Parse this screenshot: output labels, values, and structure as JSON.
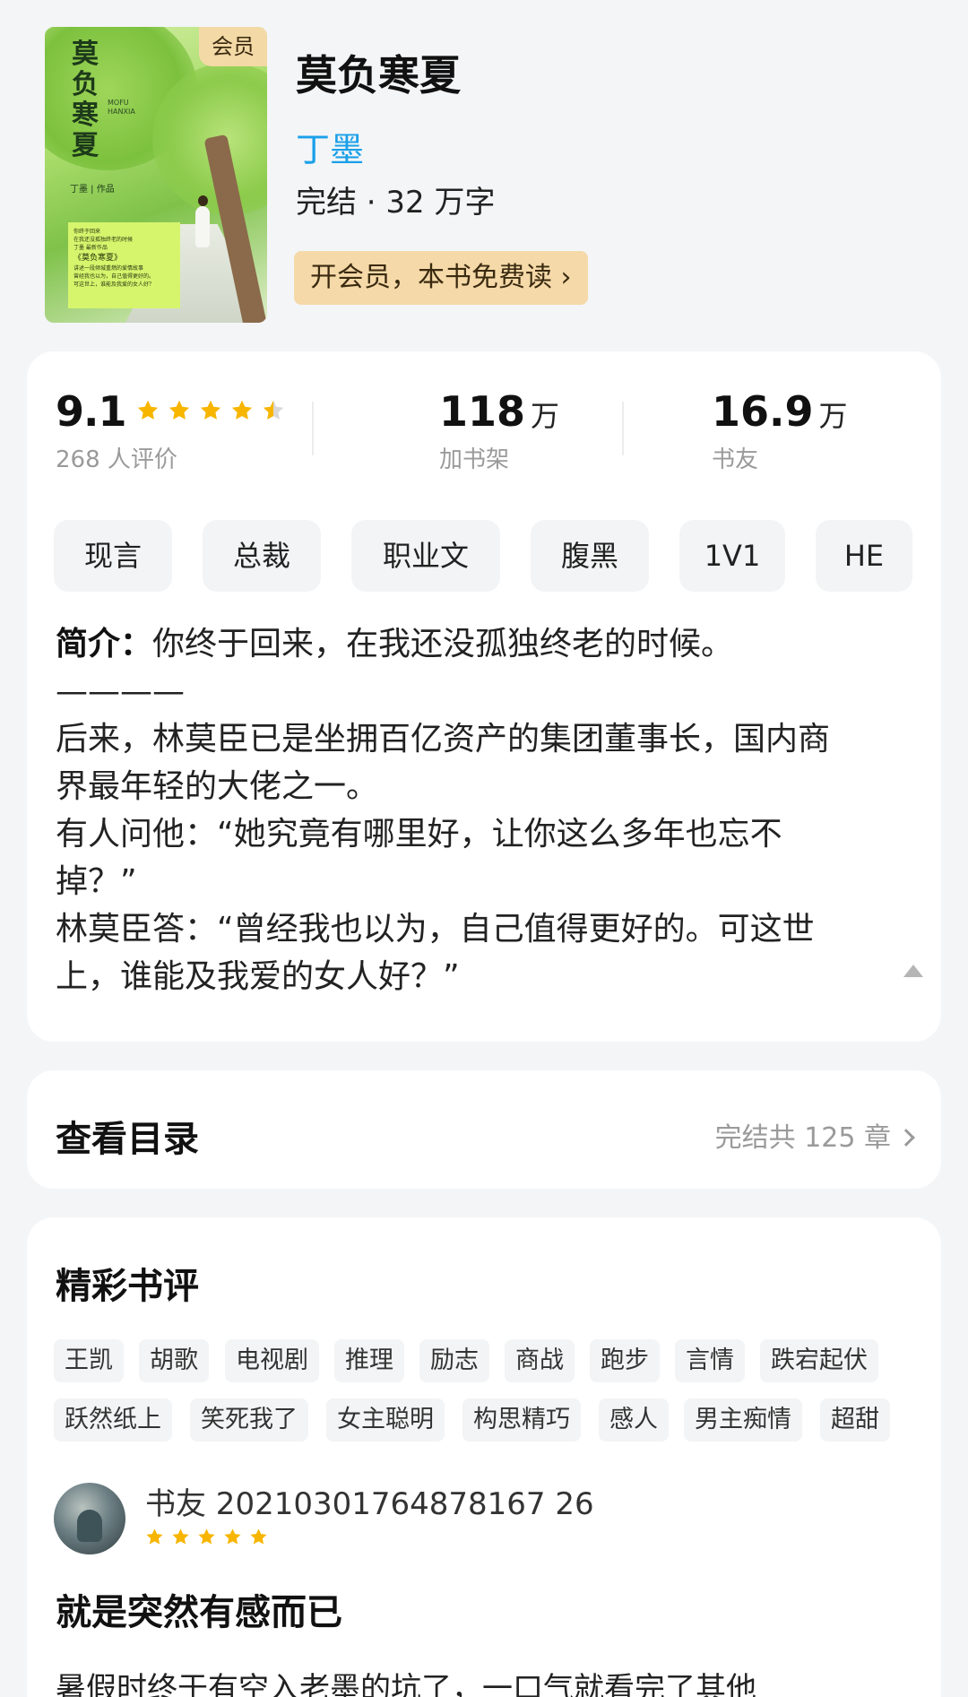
{
  "book": {
    "title": "莫负寒夏",
    "author": "丁墨",
    "meta": "完结 · 32 万字",
    "badge": "会员",
    "vip_button": "开会员，本书免费读 ›",
    "cover": {
      "title": "莫负\n寒夏",
      "latin": "MOFU\nHANXIA",
      "author_line": "丁墨 | 作品",
      "box_lines": [
        "你终于回来",
        "在我还没孤独终老的时候",
        "丁墨 最新作品"
      ],
      "box_book": "《莫负寒夏》",
      "box_tail": [
        "讲述一段倾城重燃的爱情故事",
        "曾经我也以为，自己值得更好的。",
        "可这世上，谁能及我爱的女人好？"
      ]
    }
  },
  "stats": {
    "score": "9.1",
    "rating_count": "268 人评价",
    "shelf_value": "118",
    "shelf_unit": "万",
    "shelf_label": "加书架",
    "friends_value": "16.9",
    "friends_unit": "万",
    "friends_label": "书友",
    "star_rating": 4.5,
    "star_color": "#f7b500"
  },
  "tags": [
    "现言",
    "总裁",
    "职业文",
    "腹黑",
    "1V1",
    "HE"
  ],
  "intro": {
    "label": "简介",
    "lines": [
      "你终于回来，在我还没孤独终老的时候。",
      "————",
      "后来，林莫臣已是坐拥百亿资产的集团董事长，国内商",
      "界最年轻的大佬之一。",
      "有人问他：“她究竟有哪里好，让你这么多年也忘不",
      "掉？”",
      "林莫臣答：“曾经我也以为，自己值得更好的。可这世",
      "上，谁能及我爱的女人好？”"
    ]
  },
  "catalog": {
    "title": "查看目录",
    "info": "完结共 125 章"
  },
  "reviews": {
    "title": "精彩书评",
    "tags_row1": [
      "王凯",
      "胡歌",
      "电视剧",
      "推理",
      "励志",
      "商战",
      "跑步",
      "言情",
      "跌宕起伏"
    ],
    "tags_row2": [
      "跃然纸上",
      "笑死我了",
      "女主聪明",
      "构思精巧",
      "感人",
      "男主痴情",
      "超甜"
    ],
    "first": {
      "user": "书友 20210301764878167 26",
      "stars": 5,
      "heading": "就是突然有感而已",
      "text": "暑假时终于有空入老墨的坑了，一口气就看完了其他"
    }
  },
  "colors": {
    "accent_blue": "#1aa0e8",
    "vip_gold": "#f5d9a8",
    "star": "#f7b500"
  }
}
